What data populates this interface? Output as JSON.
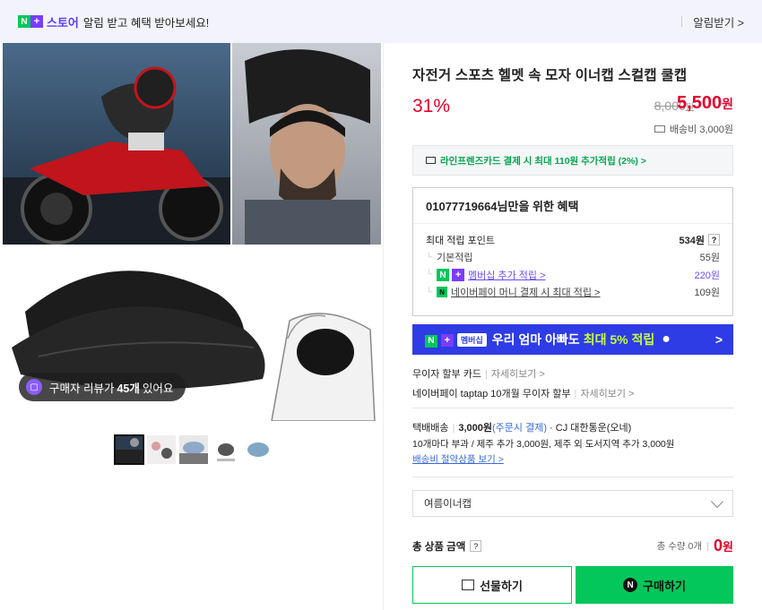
{
  "topbar": {
    "badge_n": "N",
    "badge_plus": "+",
    "store": "스토어",
    "message": "알림 받고 혜택 받아보세요!",
    "alarm": "알림받기 >"
  },
  "gallery": {
    "review_prefix": "구매자 리뷰가",
    "review_count": "45개",
    "review_suffix": "있어요"
  },
  "product": {
    "title": "자전거 스포츠 헬멧 속 모자 이너캡 스컬캡 쿨캡",
    "discount": "31%",
    "original_price": "8,000",
    "original_unit": "원",
    "sale_price": "5,500",
    "sale_unit": "원",
    "shipping_fee": "배송비 3,000원"
  },
  "card_promo": "라인프렌즈카드 결제 시 최대 110원 추가적립 (2%) >",
  "benefit": {
    "header": "01077719664님만을 위한 혜택",
    "max_label": "최대 적립 포인트",
    "max_value": "534원",
    "q": "?",
    "rows": [
      {
        "label": "기본적립",
        "value": "55원"
      },
      {
        "label": "멤버십 추가 적립 >",
        "value": "220원"
      },
      {
        "label": "네이버페이 머니 결제 시 최대 적립 >",
        "value": "109원"
      }
    ]
  },
  "banner": {
    "tag": "멤버십",
    "text": "우리 엄마 아빠도",
    "highlight": "최대 5% 적립",
    "chev": ">"
  },
  "installments": {
    "row1_label": "무이자 할부 카드",
    "row1_link": "자세히보기 >",
    "row2_label": "네이버페이 taptap 10개월 무이자 할부",
    "row2_link": "자세히보기 >"
  },
  "shipping": {
    "method": "택배배송",
    "price": "3,000원",
    "price_note": "(주문시 결제)",
    "courier": "· CJ 대한통운(오네)",
    "note": "10개마다 부과 / 제주 추가 3,000원, 제주 외 도서지역 추가 3,000원",
    "link": "배송비 절약상품 보기 >"
  },
  "option": {
    "selected": "여름이너캡"
  },
  "total": {
    "label": "총 상품 금액",
    "q": "?",
    "qty": "총 수량 0개",
    "amount": "0",
    "unit": "원"
  },
  "buttons": {
    "gift": "선물하기",
    "buy": "구매하기",
    "buy_icon": "N"
  },
  "colors": {
    "accent_green": "#03c75a",
    "price_red": "#e4002b",
    "banner_blue": "#2e3ce6",
    "membership_purple": "#6b4cff"
  }
}
